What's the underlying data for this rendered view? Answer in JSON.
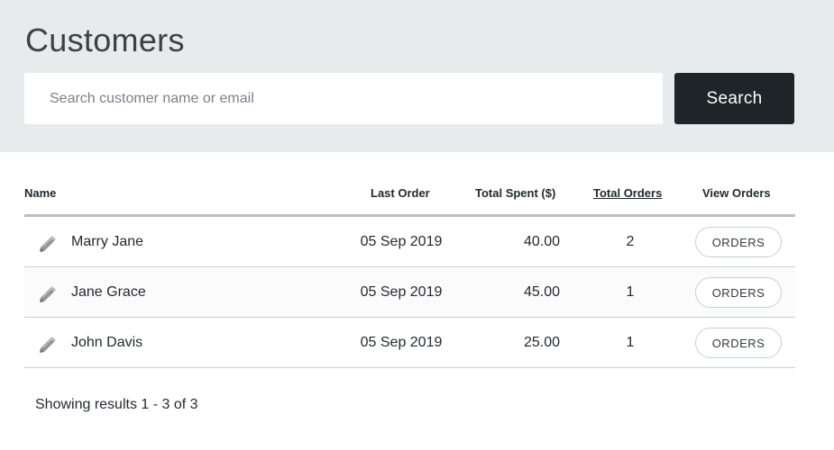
{
  "header": {
    "title": "Customers",
    "search_placeholder": "Search customer name or email",
    "search_value": "",
    "search_button_label": "Search"
  },
  "table": {
    "columns": {
      "name": "Name",
      "last_order": "Last Order",
      "total_spent": "Total Spent ($)",
      "total_orders": "Total Orders",
      "view_orders": "View Orders"
    },
    "rows": [
      {
        "name": "Marry Jane",
        "last_order": "05 Sep 2019",
        "total_spent": "40.00",
        "total_orders": "2",
        "action_label": "ORDERS"
      },
      {
        "name": "Jane Grace",
        "last_order": "05 Sep 2019",
        "total_spent": "45.00",
        "total_orders": "1",
        "action_label": "ORDERS"
      },
      {
        "name": "John Davis",
        "last_order": "05 Sep 2019",
        "total_spent": "25.00",
        "total_orders": "1",
        "action_label": "ORDERS"
      }
    ],
    "row_icon": "pencil-icon"
  },
  "footer": {
    "results_text": "Showing results 1 - 3 of 3"
  },
  "colors": {
    "header_bg": "#e8ebec",
    "button_dark": "#1e2529",
    "divider": "#c9cfd2"
  }
}
